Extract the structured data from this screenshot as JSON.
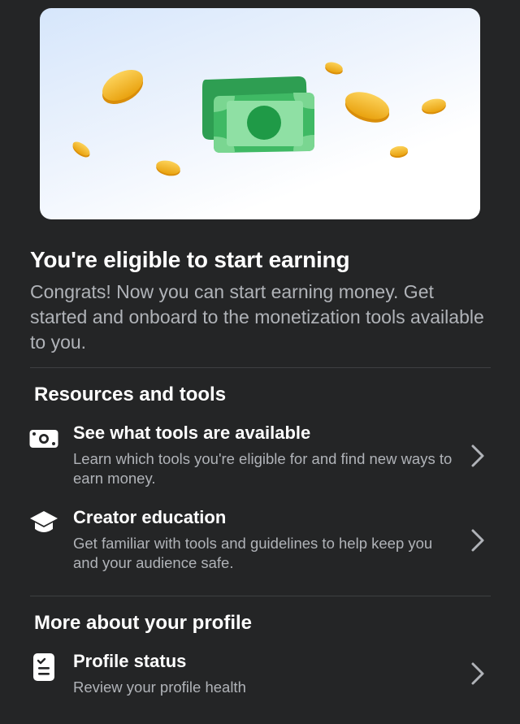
{
  "hero": {
    "illustration": "money-coins-illustration"
  },
  "headline": "You're eligible to start earning",
  "description": "Congrats! Now you can start earning money. Get started and onboard to the monetization tools available to you.",
  "sections": {
    "resources": {
      "title": "Resources and tools",
      "items": [
        {
          "icon": "money-bill-icon",
          "title": "See what tools are available",
          "subtitle": "Learn which tools you're eligible for and find new ways to earn money."
        },
        {
          "icon": "graduation-cap-icon",
          "title": "Creator education",
          "subtitle": "Get familiar with tools and guidelines to help keep you and your audience safe."
        }
      ]
    },
    "profile": {
      "title": "More about your profile",
      "items": [
        {
          "icon": "clipboard-check-icon",
          "title": "Profile status",
          "subtitle": "Review your profile health"
        }
      ]
    }
  },
  "colors": {
    "background": "#242526",
    "text_primary": "#ffffff",
    "text_secondary": "#b0b3b8",
    "money_green": "#31a24c",
    "coin_gold": "#f7b928"
  }
}
